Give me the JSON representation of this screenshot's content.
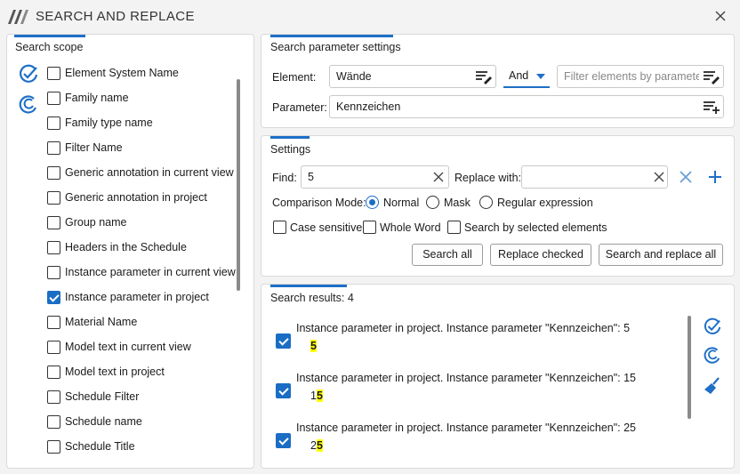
{
  "window": {
    "title": "SEARCH AND REPLACE"
  },
  "scope": {
    "title": "Search scope",
    "items": [
      {
        "label": "Element System Name",
        "checked": false
      },
      {
        "label": "Family name",
        "checked": false
      },
      {
        "label": "Family type name",
        "checked": false
      },
      {
        "label": "Filter Name",
        "checked": false
      },
      {
        "label": "Generic annotation in current view",
        "checked": false
      },
      {
        "label": "Generic annotation in project",
        "checked": false
      },
      {
        "label": "Group name",
        "checked": false
      },
      {
        "label": "Headers in the Schedule",
        "checked": false
      },
      {
        "label": "Instance parameter in current view",
        "checked": false
      },
      {
        "label": "Instance parameter in project",
        "checked": true
      },
      {
        "label": "Material Name",
        "checked": false
      },
      {
        "label": "Model text in current view",
        "checked": false
      },
      {
        "label": "Model text in project",
        "checked": false
      },
      {
        "label": "Schedule Filter",
        "checked": false
      },
      {
        "label": "Schedule name",
        "checked": false
      },
      {
        "label": "Schedule Title",
        "checked": false
      }
    ]
  },
  "param_settings": {
    "title": "Search parameter settings",
    "element_label": "Element:",
    "element_value": "Wände",
    "operator": "And",
    "filter_placeholder": "Filter elements by parameter:",
    "parameter_label": "Parameter:",
    "parameter_value": "Kennzeichen"
  },
  "settings": {
    "title": "Settings",
    "find_label": "Find:",
    "find_value": "5",
    "replace_label": "Replace with:",
    "replace_value": "",
    "mode_label": "Comparison Mode:",
    "modes": [
      {
        "label": "Normal",
        "selected": true
      },
      {
        "label": "Mask",
        "selected": false
      },
      {
        "label": "Regular expression",
        "selected": false
      }
    ],
    "options": [
      {
        "label": "Case sensitive",
        "checked": false
      },
      {
        "label": "Whole Word",
        "checked": false
      },
      {
        "label": "Search by selected elements",
        "checked": false
      }
    ],
    "buttons": {
      "search_all": "Search all",
      "replace_checked": "Replace checked",
      "search_replace_all": "Search and replace all"
    }
  },
  "results": {
    "title": "Search results: 4",
    "items": [
      {
        "title": "Instance parameter in project. Instance parameter \"Kennzeichen\": 5",
        "value_prefix": "",
        "value_match": "5",
        "checked": true
      },
      {
        "title": "Instance parameter in project. Instance parameter \"Kennzeichen\": 15",
        "value_prefix": "1",
        "value_match": "5",
        "checked": true
      },
      {
        "title": "Instance parameter in project. Instance parameter \"Kennzeichen\": 25",
        "value_prefix": "2",
        "value_match": "5",
        "checked": true
      }
    ]
  },
  "colors": {
    "accent": "#1e6fc7",
    "highlight": "#ffff00"
  },
  "icons": [
    "app-logo-icon",
    "close-icon",
    "check-all-icon",
    "uncheck-all-icon",
    "edit-list-icon",
    "add-list-icon",
    "clear-icon",
    "add-icon",
    "chevron-down-icon",
    "broom-icon"
  ]
}
